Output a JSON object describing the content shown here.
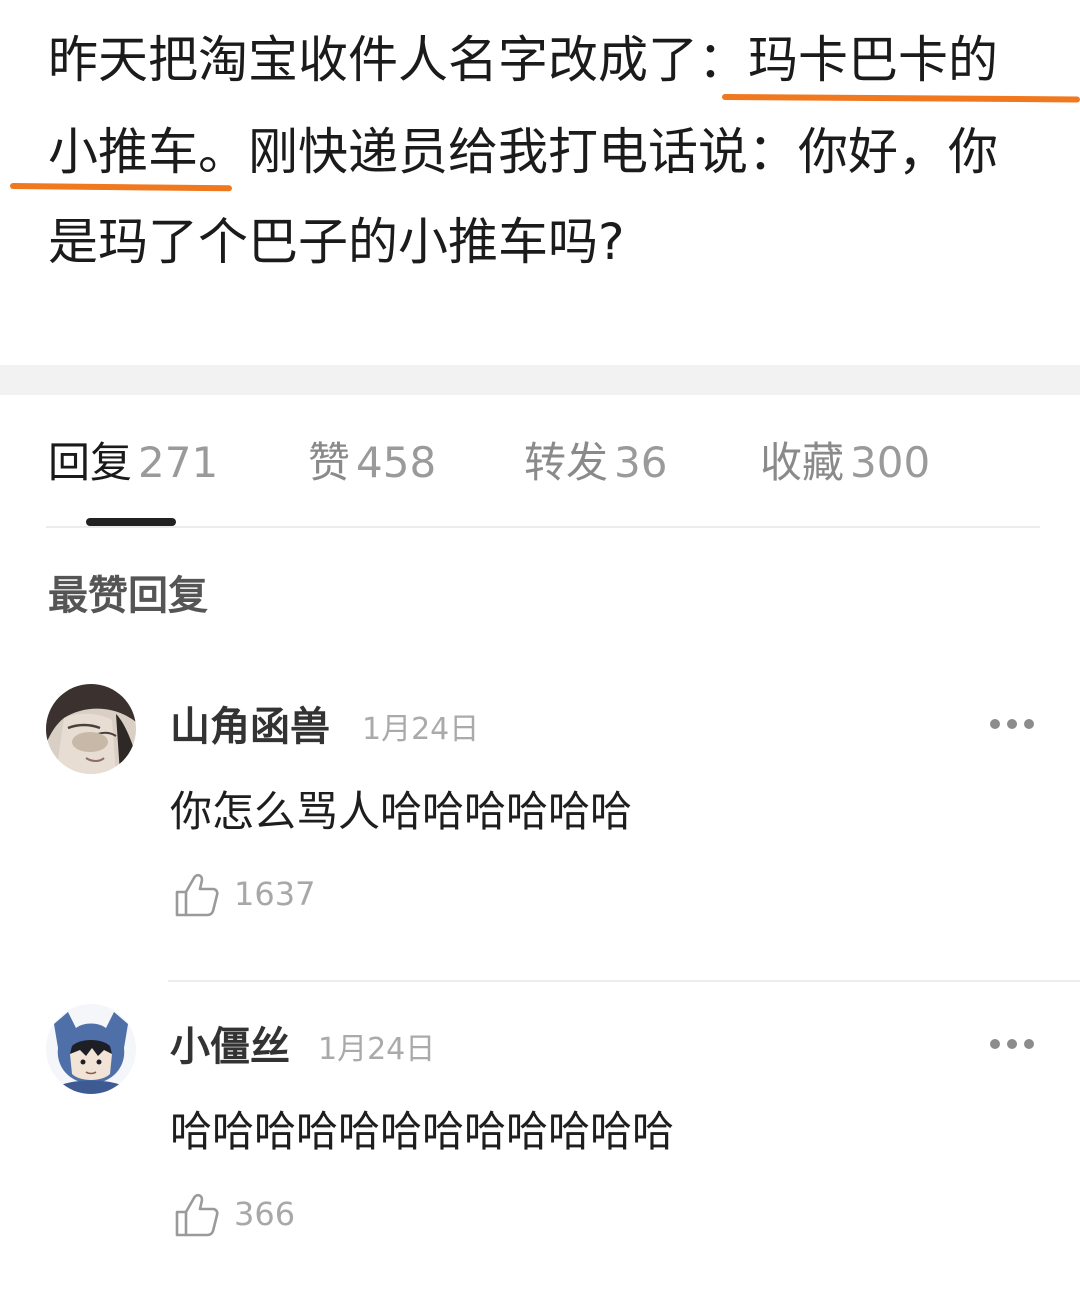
{
  "post": {
    "line1_plain": "昨天把淘宝收件人名字改成了：",
    "line1_marked": "玛卡巴卡的",
    "line2_marked": "小推车。",
    "line2_plain": "刚快递员给我打电话说：你好，你",
    "line3": "是玛了个巴子的小推车吗?",
    "highlight_color": "#f0781e"
  },
  "tabs": [
    {
      "label": "回复",
      "count": "271",
      "active": true
    },
    {
      "label": "赞",
      "count": "458",
      "active": false
    },
    {
      "label": "转发",
      "count": "36",
      "active": false
    },
    {
      "label": "收藏",
      "count": "300",
      "active": false
    }
  ],
  "section_title": "最赞回复",
  "comments": [
    {
      "username": "山角函兽",
      "date": "1月24日",
      "text": "你怎么骂人哈哈哈哈哈哈",
      "likes": "1637",
      "avatar": "avatar-illustrated-character",
      "more_icon": "more-dots-icon",
      "like_icon": "thumbs-up-icon"
    },
    {
      "username": "小僵丝",
      "date": "1月24日",
      "text": "哈哈哈哈哈哈哈哈哈哈哈哈",
      "likes": "366",
      "avatar": "avatar-blue-hooded-character",
      "more_icon": "more-dots-icon",
      "like_icon": "thumbs-up-icon"
    }
  ]
}
